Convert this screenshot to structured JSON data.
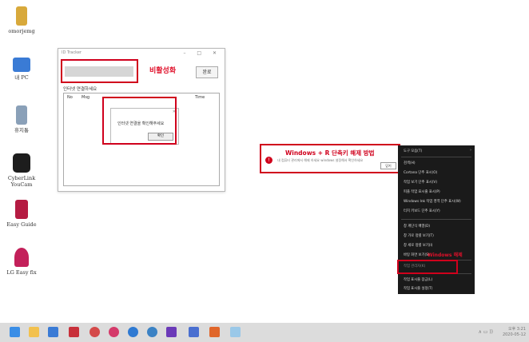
{
  "desktop": {
    "icons": [
      {
        "label": "omorjemg",
        "color": "#d8a93b"
      },
      {
        "label": "내 PC",
        "color": "#3a7bd5"
      },
      {
        "label": "휴지통",
        "color": "#8aa0b8"
      },
      {
        "label": "CyberLink YouCam",
        "color": "#1d1d1d"
      },
      {
        "label": "Easy Guide",
        "color": "#b51b42"
      },
      {
        "label": "LG Easy fix",
        "color": "#c3205a"
      }
    ]
  },
  "app_window": {
    "title": "ID Tracker",
    "controls": "– □ ✕",
    "button": "완료",
    "section_label": "인터넷 연결하세요",
    "columns": [
      "No",
      "Msg",
      "Time"
    ],
    "annotation": "비활성화"
  },
  "modal": {
    "message": "인터넷 연결을 확인해주세요",
    "ok": "확인",
    "close": "✕"
  },
  "banner": {
    "title": "Windows + R 단축키 해제 방법",
    "description": "내 컴퓨터 관리에서 해제 하세요 windows 설정해서 확인하세요",
    "button": "닫기"
  },
  "context_menu": {
    "items": [
      "도구 모음(T)",
      "검색(H)",
      "Cortana 단추 표시(O)",
      "작업 보기 단추 표시(V)",
      "피플 작업 표시줄 표시(P)",
      "Windows Ink 작업 영역 단추 표시(W)",
      "터치 키보드 단추 표시(Y)",
      "창 계단식 배열(D)",
      "창 가로 정렬 보기(T)",
      "창 세로 정렬 보기(I)",
      "바탕 화면 보기(S)",
      "작업 관리자(K)",
      "작업 표시줄 잠금(L)",
      "작업 표시줄 설정(T)"
    ],
    "annotation": "Windows 해제"
  },
  "taskbar": {
    "icons": [
      {
        "name": "start-icon",
        "color": "#3a8ee6"
      },
      {
        "name": "explorer-icon",
        "color": "#f2c14e"
      },
      {
        "name": "store-icon",
        "color": "#3a7bd5"
      },
      {
        "name": "app-red-icon",
        "color": "#c8303a"
      },
      {
        "name": "app-circle-icon",
        "color": "#d44a4a"
      },
      {
        "name": "app-u-icon",
        "color": "#d43a6a"
      },
      {
        "name": "edge-icon",
        "color": "#2f7ad2"
      },
      {
        "name": "chrome-icon",
        "color": "#3b82c4"
      },
      {
        "name": "app-purple-icon",
        "color": "#6b3ab8"
      },
      {
        "name": "app-blue-icon",
        "color": "#4a6fd0"
      },
      {
        "name": "app-orange-icon",
        "color": "#e0662a"
      },
      {
        "name": "app-light-icon",
        "color": "#9ac8e8"
      }
    ],
    "tray": "∧ ▭ ))",
    "time": "오후 3:21",
    "date": "2020-05-12"
  }
}
